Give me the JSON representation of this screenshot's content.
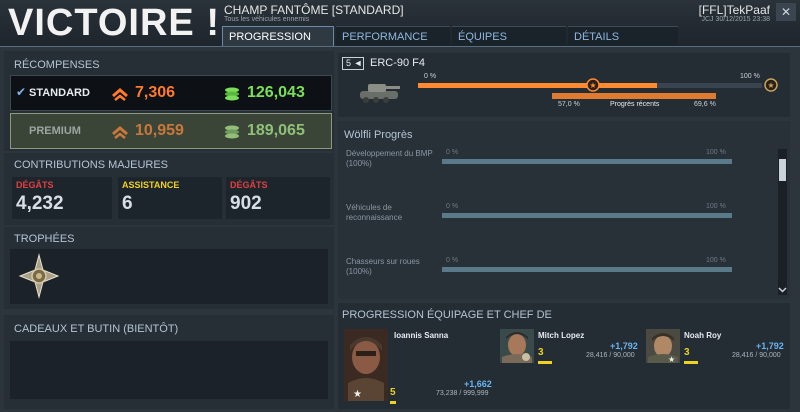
{
  "header": {
    "result": "VICTOIRE !",
    "mode_title": "CHAMP FANTÔME [STANDARD]",
    "mode_subtitle": "Tous les véhicules ennemis",
    "player": "[FFL]TekPaaf",
    "datetime": "JCJ 30/12/2015 23:38",
    "close_label": "✕"
  },
  "tabs": [
    {
      "label": "PROGRESSION",
      "active": true
    },
    {
      "label": "PERFORMANCE",
      "active": false
    },
    {
      "label": "ÉQUIPES",
      "active": false
    },
    {
      "label": "DÉTAILS",
      "active": false
    }
  ],
  "rewards": {
    "title": "RÉCOMPENSES",
    "standard": {
      "label": "STANDARD",
      "xp": "7,306",
      "credits": "126,043"
    },
    "premium": {
      "label": "PREMIUM",
      "xp": "10,959",
      "credits": "189,065"
    }
  },
  "contributions": {
    "title": "CONTRIBUTIONS MAJEURES",
    "items": [
      {
        "label": "DÉGÂTS",
        "value": "4,232",
        "color": "#e04040"
      },
      {
        "label": "ASSISTANCE",
        "value": "6",
        "color": "#f0d020"
      },
      {
        "label": "DÉGÂTS",
        "value": "902",
        "color": "#e04040"
      }
    ]
  },
  "trophies": {
    "title": "TROPHÉES"
  },
  "gifts": {
    "title": "CADEAUX ET BUTIN (BIENTÔT)"
  },
  "tank": {
    "tier": "5 ◄",
    "name": "ERC-90 F4",
    "start_pct": "0 %",
    "end_pct": "100 %",
    "recent_left": "57,0 %",
    "recent_label": "Progrès récents",
    "recent_right": "69,6 %",
    "progress_fraction": 0.696
  },
  "wolfli": {
    "title": "Wölfli Progrès",
    "rows": [
      {
        "label": "Développement du BMP (100%)",
        "start": "0 %",
        "end": "100 %"
      },
      {
        "label": "Véhicules de reconnaissance",
        "start": "0 %",
        "end": "100 %"
      },
      {
        "label": "Chasseurs sur roues (100%)",
        "start": "0 %",
        "end": "100 %"
      }
    ]
  },
  "crew": {
    "title": "PROGRESSION ÉQUIPAGE ET CHEF DE",
    "members": [
      {
        "name": "Ioannis Sanna",
        "level": "5",
        "gain": "+1,662",
        "xp": "73,238 / 999,999"
      },
      {
        "name": "Mitch Lopez",
        "level": "3",
        "gain": "+1,792",
        "xp": "28,416 / 90,000"
      },
      {
        "name": "Noah Roy",
        "level": "3",
        "gain": "+1,792",
        "xp": "28,416 / 90,000"
      }
    ]
  },
  "colors": {
    "xp": "#ff7a2a",
    "credits": "#7adf58",
    "accent": "#6ab4f0",
    "progress": "#ff8a30"
  }
}
